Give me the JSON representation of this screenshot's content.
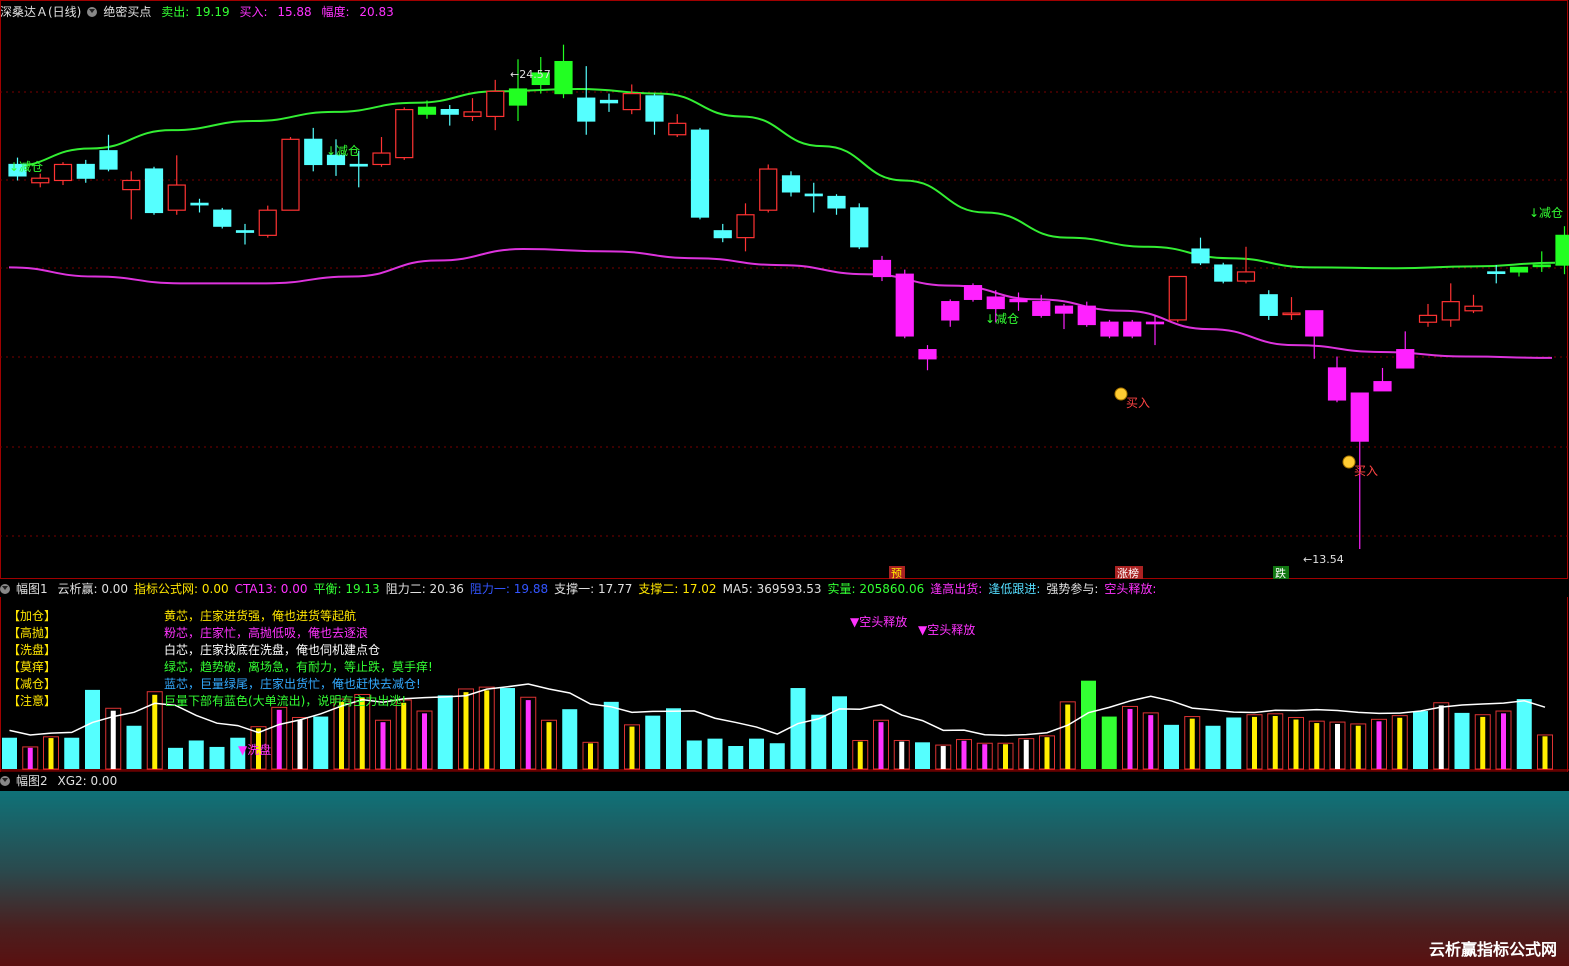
{
  "main_header": {
    "title": "深桑达Ａ(日线)",
    "indicator": "绝密买点",
    "sell_label": "卖出:",
    "sell_value": "19.19",
    "buy_label": "买入:",
    "buy_value": "15.88",
    "range_label": "幅度:",
    "range_value": "20.83"
  },
  "pane1_header": {
    "name": "幅图1",
    "items": [
      {
        "text": "云析赢: 0.00",
        "color": "#e0e0e0"
      },
      {
        "text": "指标公式网: 0.00",
        "color": "#ffe600"
      },
      {
        "text": "CTA13: 0.00",
        "color": "#ff33ff"
      },
      {
        "text": "平衡: 19.13",
        "color": "#33ff33"
      },
      {
        "text": "阻力二: 20.36",
        "color": "#e0e0e0"
      },
      {
        "text": "阻力一: 19.88",
        "color": "#3355ff"
      },
      {
        "text": "支撑一: 17.77",
        "color": "#e0e0e0"
      },
      {
        "text": "支撑二: 17.02",
        "color": "#ffe600"
      },
      {
        "text": "MA5: 369593.53",
        "color": "#e0e0e0"
      },
      {
        "text": "实量: 205860.06",
        "color": "#33ff33"
      },
      {
        "text": "逢高出货:",
        "color": "#ff33ff"
      },
      {
        "text": "逢低跟进:",
        "color": "#55ddff"
      },
      {
        "text": "强势参与:",
        "color": "#e0e0e0"
      },
      {
        "text": "空头释放:",
        "color": "#ff33ff"
      }
    ]
  },
  "pane2_header": {
    "name": "幅图2",
    "xg2": "XG2: 0.00"
  },
  "legend": [
    {
      "key": "【加仓】",
      "text": "黄芯，庄家进货强，俺也进货等起航",
      "color": "#ffe600"
    },
    {
      "key": "【高抛】",
      "text": "粉芯，庄家忙，高抛低吸，俺也去逐浪",
      "color": "#ff33ff"
    },
    {
      "key": "【洗盘】",
      "text": "白芯，庄家找底在洗盘，俺也伺机建点仓",
      "color": "#ffffff"
    },
    {
      "key": "【莫痒】",
      "text": "绿芯，趋势破，离场急，有耐力，等止跌，莫手痒!",
      "color": "#33ff33"
    },
    {
      "key": "【减仓】",
      "text": "蓝芯，巨量绿尾，庄家出货忙，俺也赶快去减仓!",
      "color": "#33aaff"
    },
    {
      "key": "【注意】",
      "text": "巨量下部有蓝色(大单流出)，说明有主力出逃!",
      "color": "#33ff33"
    }
  ],
  "annotations": {
    "reduce": "↓减仓",
    "buy": "买入",
    "high_price": "24.57",
    "low_price": "13.54",
    "tag_yu": "预",
    "tag_zhang": "涨榜",
    "tag_die": "跌",
    "short_release": "▼空头释放",
    "wash": "▼洗盘"
  },
  "brand": "云析赢指标公式网",
  "chart_data": {
    "type": "candlestick",
    "title": "深桑达Ａ(日线)",
    "high": 24.57,
    "low": 13.54,
    "candles": [
      {
        "o": 21.95,
        "c": 21.7,
        "h": 22.1,
        "l": 21.6,
        "col": "cyan"
      },
      {
        "o": 21.55,
        "c": 21.65,
        "h": 21.75,
        "l": 21.45,
        "col": "red"
      },
      {
        "o": 21.6,
        "c": 21.95,
        "h": 22.0,
        "l": 21.5,
        "col": "red"
      },
      {
        "o": 21.95,
        "c": 21.65,
        "h": 22.05,
        "l": 21.55,
        "col": "cyan"
      },
      {
        "o": 22.25,
        "c": 21.85,
        "h": 22.6,
        "l": 21.8,
        "col": "cyan"
      },
      {
        "o": 21.4,
        "c": 21.6,
        "h": 21.8,
        "l": 20.75,
        "col": "red"
      },
      {
        "o": 21.85,
        "c": 20.9,
        "h": 21.9,
        "l": 20.85,
        "col": "cyan"
      },
      {
        "o": 20.95,
        "c": 21.5,
        "h": 22.15,
        "l": 20.85,
        "col": "red"
      },
      {
        "o": 21.1,
        "c": 21.1,
        "h": 21.2,
        "l": 20.9,
        "col": "cyan"
      },
      {
        "o": 20.95,
        "c": 20.6,
        "h": 21.0,
        "l": 20.55,
        "col": "cyan"
      },
      {
        "o": 20.5,
        "c": 20.5,
        "h": 20.65,
        "l": 20.2,
        "col": "cyan"
      },
      {
        "o": 20.4,
        "c": 20.95,
        "h": 21.05,
        "l": 20.35,
        "col": "red"
      },
      {
        "o": 20.95,
        "c": 22.5,
        "h": 22.55,
        "l": 20.95,
        "col": "red"
      },
      {
        "o": 22.5,
        "c": 21.95,
        "h": 22.75,
        "l": 21.8,
        "col": "cyan"
      },
      {
        "o": 22.15,
        "c": 21.95,
        "h": 22.5,
        "l": 21.7,
        "col": "cyan"
      },
      {
        "o": 21.95,
        "c": 21.95,
        "h": 22.25,
        "l": 21.45,
        "col": "cyan"
      },
      {
        "o": 21.95,
        "c": 22.2,
        "h": 22.55,
        "l": 21.9,
        "col": "red"
      },
      {
        "o": 22.1,
        "c": 23.15,
        "h": 23.2,
        "l": 22.05,
        "col": "red"
      },
      {
        "o": 23.2,
        "c": 23.05,
        "h": 23.35,
        "l": 22.95,
        "col": "green"
      },
      {
        "o": 23.15,
        "c": 23.05,
        "h": 23.25,
        "l": 22.8,
        "col": "cyan"
      },
      {
        "o": 23.0,
        "c": 23.1,
        "h": 23.4,
        "l": 22.9,
        "col": "red"
      },
      {
        "o": 23.0,
        "c": 23.55,
        "h": 23.8,
        "l": 22.7,
        "col": "red"
      },
      {
        "o": 23.25,
        "c": 23.6,
        "h": 24.25,
        "l": 22.9,
        "col": "green"
      },
      {
        "o": 23.7,
        "c": 23.95,
        "h": 24.3,
        "l": 23.5,
        "col": "green"
      },
      {
        "o": 23.5,
        "c": 24.2,
        "h": 24.57,
        "l": 23.4,
        "col": "green"
      },
      {
        "o": 23.4,
        "c": 22.9,
        "h": 24.1,
        "l": 22.6,
        "col": "cyan"
      },
      {
        "o": 23.3,
        "c": 23.35,
        "h": 23.5,
        "l": 23.1,
        "col": "cyan"
      },
      {
        "o": 23.15,
        "c": 23.5,
        "h": 23.7,
        "l": 23.05,
        "col": "red"
      },
      {
        "o": 23.45,
        "c": 22.9,
        "h": 23.5,
        "l": 22.6,
        "col": "cyan"
      },
      {
        "o": 22.6,
        "c": 22.85,
        "h": 23.05,
        "l": 22.55,
        "col": "red"
      },
      {
        "o": 22.7,
        "c": 20.8,
        "h": 22.75,
        "l": 20.75,
        "col": "cyan"
      },
      {
        "o": 20.5,
        "c": 20.35,
        "h": 20.65,
        "l": 20.25,
        "col": "cyan"
      },
      {
        "o": 20.35,
        "c": 20.85,
        "h": 21.1,
        "l": 20.05,
        "col": "red"
      },
      {
        "o": 20.95,
        "c": 21.85,
        "h": 21.95,
        "l": 20.9,
        "col": "red"
      },
      {
        "o": 21.7,
        "c": 21.35,
        "h": 21.8,
        "l": 21.25,
        "col": "cyan"
      },
      {
        "o": 21.3,
        "c": 21.3,
        "h": 21.55,
        "l": 20.9,
        "col": "cyan"
      },
      {
        "o": 21.25,
        "c": 21.0,
        "h": 21.3,
        "l": 20.85,
        "col": "cyan"
      },
      {
        "o": 21.0,
        "c": 20.15,
        "h": 21.1,
        "l": 20.1,
        "col": "cyan"
      },
      {
        "o": 19.85,
        "c": 19.5,
        "h": 19.95,
        "l": 19.4,
        "col": "magenta"
      },
      {
        "o": 19.55,
        "c": 18.2,
        "h": 19.65,
        "l": 18.15,
        "col": "magenta"
      },
      {
        "o": 17.9,
        "c": 17.7,
        "h": 18.0,
        "l": 17.45,
        "col": "magenta"
      },
      {
        "o": 18.55,
        "c": 18.95,
        "h": 19.0,
        "l": 18.4,
        "col": "magenta"
      },
      {
        "o": 19.3,
        "c": 19.0,
        "h": 19.35,
        "l": 18.95,
        "col": "magenta"
      },
      {
        "o": 19.05,
        "c": 18.8,
        "h": 19.2,
        "l": 18.5,
        "col": "magenta"
      },
      {
        "o": 19.0,
        "c": 18.95,
        "h": 19.15,
        "l": 18.75,
        "col": "magenta"
      },
      {
        "o": 18.95,
        "c": 18.65,
        "h": 19.1,
        "l": 18.6,
        "col": "magenta"
      },
      {
        "o": 18.85,
        "c": 18.7,
        "h": 18.9,
        "l": 18.35,
        "col": "magenta"
      },
      {
        "o": 18.85,
        "c": 18.45,
        "h": 18.95,
        "l": 18.4,
        "col": "magenta"
      },
      {
        "o": 18.5,
        "c": 18.2,
        "h": 18.55,
        "l": 18.15,
        "col": "magenta"
      },
      {
        "o": 18.5,
        "c": 18.2,
        "h": 18.55,
        "l": 18.15,
        "col": "magenta"
      },
      {
        "o": 18.5,
        "c": 18.5,
        "h": 18.65,
        "l": 18.0,
        "col": "magenta"
      },
      {
        "o": 18.55,
        "c": 19.5,
        "h": 19.5,
        "l": 18.5,
        "col": "red"
      },
      {
        "o": 20.1,
        "c": 19.8,
        "h": 20.35,
        "l": 19.75,
        "col": "cyan"
      },
      {
        "o": 19.75,
        "c": 19.4,
        "h": 19.8,
        "l": 19.35,
        "col": "cyan"
      },
      {
        "o": 19.4,
        "c": 19.6,
        "h": 20.15,
        "l": 19.35,
        "col": "red"
      },
      {
        "o": 19.1,
        "c": 18.65,
        "h": 19.2,
        "l": 18.55,
        "col": "cyan"
      },
      {
        "o": 18.7,
        "c": 18.7,
        "h": 19.05,
        "l": 18.55,
        "col": "red"
      },
      {
        "o": 18.75,
        "c": 18.2,
        "h": 18.75,
        "l": 17.7,
        "col": "magenta"
      },
      {
        "o": 17.5,
        "c": 16.8,
        "h": 17.75,
        "l": 16.75,
        "col": "magenta"
      },
      {
        "o": 16.95,
        "c": 15.9,
        "h": 16.9,
        "l": 13.54,
        "col": "magenta"
      },
      {
        "o": 17.0,
        "c": 17.2,
        "h": 17.5,
        "l": 17.0,
        "col": "magenta"
      },
      {
        "o": 17.5,
        "c": 17.9,
        "h": 18.3,
        "l": 17.8,
        "col": "magenta"
      },
      {
        "o": 18.5,
        "c": 18.65,
        "h": 18.9,
        "l": 18.4,
        "col": "red"
      },
      {
        "o": 18.55,
        "c": 18.95,
        "h": 19.35,
        "l": 18.4,
        "col": "red"
      },
      {
        "o": 18.75,
        "c": 18.85,
        "h": 19.1,
        "l": 18.7,
        "col": "red"
      },
      {
        "o": 19.6,
        "c": 19.6,
        "h": 19.75,
        "l": 19.35,
        "col": "cyan"
      },
      {
        "o": 19.6,
        "c": 19.7,
        "h": 19.7,
        "l": 19.5,
        "col": "green"
      },
      {
        "o": 19.75,
        "c": 19.75,
        "h": 20.05,
        "l": 19.6,
        "col": "green"
      },
      {
        "o": 20.4,
        "c": 19.75,
        "h": 20.6,
        "l": 19.55,
        "col": "green"
      },
      {
        "o": 20.4,
        "c": 19.75,
        "h": 20.6,
        "l": 19.55,
        "col": "green"
      },
      {
        "o": 20.05,
        "c": 20.4,
        "h": 20.6,
        "l": 19.7,
        "col": "cyan"
      },
      {
        "o": 20.35,
        "c": 19.85,
        "h": 20.5,
        "l": 19.4,
        "col": "green"
      }
    ],
    "green_band": [
      21.9,
      22.3,
      22.7,
      22.9,
      23.1,
      23.3,
      23.55,
      23.6,
      23.5,
      23.0,
      22.35,
      21.6,
      20.9,
      20.35,
      20.15,
      19.9,
      19.7,
      19.68,
      19.72,
      19.8
    ],
    "magenta_band": [
      19.7,
      19.5,
      19.35,
      19.35,
      19.5,
      19.85,
      20.1,
      20.05,
      19.9,
      19.75,
      19.55,
      19.3,
      19.0,
      18.75,
      18.35,
      18.0,
      17.85,
      17.75,
      17.72
    ]
  },
  "volume_data": {
    "bars": [
      34,
      24,
      35,
      34,
      86,
      66,
      47,
      84,
      23,
      31,
      24,
      34,
      46,
      67,
      56,
      57,
      76,
      81,
      53,
      75,
      63,
      80,
      87,
      89,
      88,
      78,
      53,
      65,
      29,
      73,
      48,
      58,
      66,
      31,
      33,
      25,
      33,
      28,
      88,
      59,
      79,
      31,
      53,
      31,
      29,
      26,
      32,
      28,
      28,
      33,
      36,
      73,
      96,
      57,
      68,
      61,
      48,
      57,
      47,
      56,
      59,
      60,
      56,
      52,
      51,
      49,
      54,
      58,
      63,
      72,
      61,
      59,
      63,
      76,
      37
    ],
    "core": [
      "cyan",
      "magenta",
      "yellow",
      "cyan",
      "cyan",
      "white",
      "cyan",
      "yellow",
      "cyan",
      "cyan",
      "cyan",
      "cyan",
      "yellow",
      "magenta",
      "white",
      "cyan",
      "yellow",
      "yellow",
      "magenta",
      "yellow",
      "magenta",
      "cyan",
      "yellow",
      "yellow",
      "cyan",
      "magenta",
      "yellow",
      "cyan",
      "yellow",
      "cyan",
      "yellow",
      "cyan",
      "cyan",
      "cyan",
      "cyan",
      "cyan",
      "cyan",
      "cyan",
      "cyan",
      "cyan",
      "cyan",
      "yellow",
      "magenta",
      "white",
      "cyan",
      "white",
      "magenta",
      "magenta",
      "yellow",
      "white",
      "yellow",
      "yellow",
      "green",
      "green",
      "magenta",
      "magenta",
      "cyan",
      "yellow",
      "cyan",
      "cyan",
      "yellow",
      "yellow",
      "yellow",
      "yellow",
      "white",
      "yellow",
      "magenta",
      "yellow",
      "cyan",
      "white",
      "cyan",
      "yellow",
      "magenta",
      "cyan",
      "yellow"
    ]
  }
}
